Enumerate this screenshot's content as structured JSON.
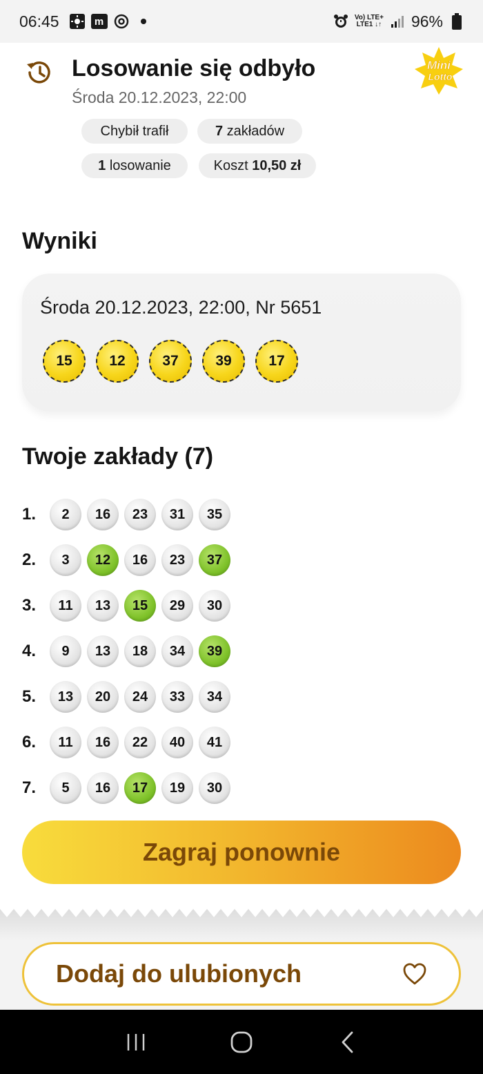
{
  "status_bar": {
    "time": "06:45",
    "m_badge": "m",
    "net_top": "Vo) LTE+",
    "net_bottom": "LTE1 ↓↑",
    "battery": "96%"
  },
  "header": {
    "title": "Losowanie się odbyło",
    "subtitle": "Środa 20.12.2023, 22:00",
    "logo_top": "Mini",
    "logo_bottom": "Lotto"
  },
  "chips": {
    "type": "Chybił trafił",
    "bets_count": "7",
    "bets_label": " zakładów",
    "draws_count": "1",
    "draws_label": " losowanie",
    "cost_label": "Koszt ",
    "cost_value": "10,50 zł"
  },
  "results": {
    "heading": "Wyniki",
    "draw_info": "Środa 20.12.2023, 22:00, Nr 5651",
    "numbers": [
      "15",
      "12",
      "37",
      "39",
      "17"
    ]
  },
  "bets": {
    "heading": "Twoje zakłady (7)",
    "rows": [
      {
        "index": "1.",
        "numbers": [
          "2",
          "16",
          "23",
          "31",
          "35"
        ],
        "hits": [
          false,
          false,
          false,
          false,
          false
        ]
      },
      {
        "index": "2.",
        "numbers": [
          "3",
          "12",
          "16",
          "23",
          "37"
        ],
        "hits": [
          false,
          true,
          false,
          false,
          true
        ]
      },
      {
        "index": "3.",
        "numbers": [
          "11",
          "13",
          "15",
          "29",
          "30"
        ],
        "hits": [
          false,
          false,
          true,
          false,
          false
        ]
      },
      {
        "index": "4.",
        "numbers": [
          "9",
          "13",
          "18",
          "34",
          "39"
        ],
        "hits": [
          false,
          false,
          false,
          false,
          true
        ]
      },
      {
        "index": "5.",
        "numbers": [
          "13",
          "20",
          "24",
          "33",
          "34"
        ],
        "hits": [
          false,
          false,
          false,
          false,
          false
        ]
      },
      {
        "index": "6.",
        "numbers": [
          "11",
          "16",
          "22",
          "40",
          "41"
        ],
        "hits": [
          false,
          false,
          false,
          false,
          false
        ]
      },
      {
        "index": "7.",
        "numbers": [
          "5",
          "16",
          "17",
          "19",
          "30"
        ],
        "hits": [
          false,
          false,
          true,
          false,
          false
        ]
      }
    ]
  },
  "actions": {
    "play_again": "Zagraj ponownie",
    "add_favorite": "Dodaj do ulubionych"
  },
  "colors": {
    "accent_brown": "#7a4808",
    "ball_yellow": "#f7d61c",
    "ball_hit_green": "#7fc22a",
    "button_gradient_start": "#f8dc3c",
    "button_gradient_end": "#ec8a1e"
  }
}
